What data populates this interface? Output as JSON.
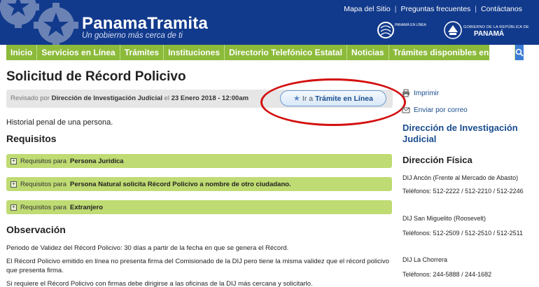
{
  "header": {
    "site_name": "PanamaTramita",
    "tagline": "Un gobierno más cerca de ti",
    "links": [
      "Mapa del Sitio",
      "Preguntas frecuentes",
      "Contáctanos"
    ],
    "logo1_text": "PANAMÁ EN LÍNEA",
    "logo2_small": "GOBIERNO DE LA REPÚBLICA DE",
    "logo2_big": "PANAMÁ"
  },
  "nav": [
    "Inicio",
    "Servicios en Línea",
    "Trámites",
    "Instituciones",
    "Directorio Telefónico Estatal",
    "Noticias",
    "Trámites disponibles en línea"
  ],
  "main": {
    "title": "Solicitud de Récord Policivo",
    "reviewed_prefix": "Revisado por",
    "reviewed_org": "Dirección de Investigación Judicial",
    "reviewed_mid": "el",
    "reviewed_date": "23 Enero 2018 - 12:00am",
    "button_prefix": "Ir a",
    "button_strong": "Trámite en Línea",
    "description": "Historial penal de una persona.",
    "requisitos_heading": "Requisitos",
    "requisitos": [
      {
        "prefix": "Requisitos para",
        "bold": "Persona Jurídica"
      },
      {
        "prefix": "Requisitos para",
        "bold": "Persona Natural solicita Récord Policivo a nombre de otro ciudadano."
      },
      {
        "prefix": "Requisitos para",
        "bold": "Extranjero"
      }
    ],
    "observacion_heading": "Observación",
    "observaciones": [
      "Periodo de Validez del Récord Policivo: 30 días a partir de la fecha en que se genera el Récord.",
      "El Récord Policivo emitido en línea no presenta firma del Comisionado de la DIJ pero tiene la misma validez que el récord policivo que presenta firma.",
      "Si requiere el Récord Policivo con firmas debe dirigirse a las oficinas de la DIJ más cercana y solicitarlo."
    ]
  },
  "sidebar": {
    "print": "Imprimir",
    "email": "Enviar por correo",
    "org_heading": "Dirección de Investigación Judicial",
    "address_heading": "Dirección Física",
    "offices": [
      {
        "name": "DIJ Ancón (Frente al Mercado de Abasto)",
        "phones": "Teléfonos: 512-2222 / 512-2210 / 512-2246"
      },
      {
        "name": "DIJ San Miguelito (Roosevelt)",
        "phones": "Teléfonos: 512-2509 / 512-2510 / 512-2511"
      },
      {
        "name": "DIJ La Chorrera",
        "phones": "Teléfonos: 244-5888 / 244-1682"
      }
    ]
  },
  "colors": {
    "header_bg": "#123a8c",
    "nav_bg": "#8cba3a",
    "req_bg": "#bfdb73",
    "link": "#1a4d8f",
    "highlight": "#d41010"
  }
}
